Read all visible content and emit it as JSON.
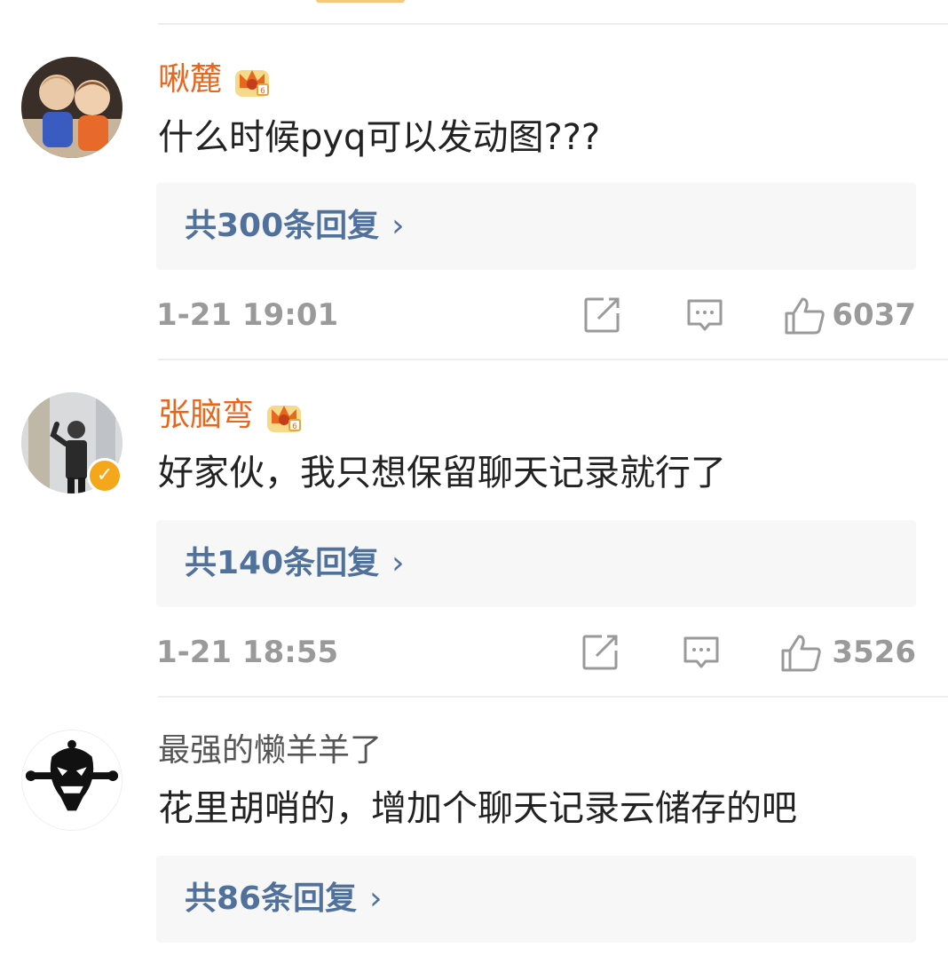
{
  "comments": [
    {
      "username": "啾麓",
      "vip": true,
      "text": "什么时候pyq可以发动图???",
      "replies": "共300条回复",
      "time": "1-21 19:01",
      "likes": "6037"
    },
    {
      "username": "张脑弯",
      "vip": true,
      "verified": true,
      "text": "好家伙，我只想保留聊天记录就行了",
      "replies": "共140条回复",
      "time": "1-21 18:55",
      "likes": "3526"
    },
    {
      "username": "最强的懒羊羊了",
      "vip": false,
      "text": "花里胡哨的，增加个聊天记录云储存的吧",
      "replies": "共86条回复"
    }
  ],
  "icons": {
    "share": "share-icon",
    "comment": "comment-icon",
    "like": "thumbs-up-icon",
    "crown": "vip-crown-icon",
    "verified": "verified-badge-icon",
    "chevron": "chevron-right-icon"
  },
  "colors": {
    "vip_name": "#e8671f",
    "link": "#50719c",
    "muted": "#9a9a9a",
    "reply_bg": "#f7f7f7"
  }
}
